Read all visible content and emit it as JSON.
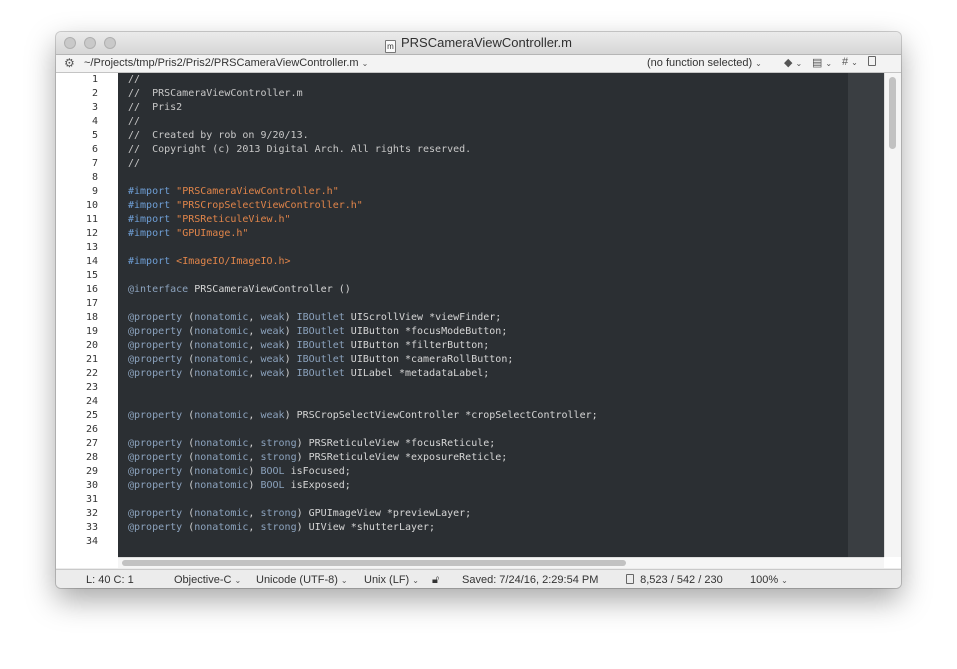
{
  "window": {
    "title": "PRSCameraViewController.m",
    "file_icon_letter": "m"
  },
  "navbar": {
    "path": "~/Projects/tmp/Pris2/Pris2/PRSCameraViewController.m",
    "function_menu": "(no function selected)",
    "caret": "⌄"
  },
  "gutter": {
    "line_numbers": [
      "1",
      "2",
      "3",
      "4",
      "5",
      "6",
      "7",
      "8",
      "9",
      "10",
      "11",
      "12",
      "13",
      "14",
      "15",
      "16",
      "17",
      "18",
      "19",
      "20",
      "21",
      "22",
      "23",
      "24",
      "25",
      "26",
      "27",
      "28",
      "29",
      "30",
      "31",
      "32",
      "33",
      "34"
    ]
  },
  "code": {
    "lines": [
      [
        {
          "t": "c",
          "v": "//"
        }
      ],
      [
        {
          "t": "c",
          "v": "//  PRSCameraViewController.m"
        }
      ],
      [
        {
          "t": "c",
          "v": "//  Pris2"
        }
      ],
      [
        {
          "t": "c",
          "v": "//"
        }
      ],
      [
        {
          "t": "c",
          "v": "//  Created by rob on 9/20/13."
        }
      ],
      [
        {
          "t": "c",
          "v": "//  Copyright (c) 2013 Digital Arch. All rights reserved."
        }
      ],
      [
        {
          "t": "c",
          "v": "//"
        }
      ],
      [],
      [
        {
          "t": "p",
          "v": "#import "
        },
        {
          "t": "s",
          "v": "\"PRSCameraViewController.h\""
        }
      ],
      [
        {
          "t": "p",
          "v": "#import "
        },
        {
          "t": "s",
          "v": "\"PRSCropSelectViewController.h\""
        }
      ],
      [
        {
          "t": "p",
          "v": "#import "
        },
        {
          "t": "s",
          "v": "\"PRSReticuleView.h\""
        }
      ],
      [
        {
          "t": "p",
          "v": "#import "
        },
        {
          "t": "s",
          "v": "\"GPUImage.h\""
        }
      ],
      [],
      [
        {
          "t": "p",
          "v": "#import "
        },
        {
          "t": "s",
          "v": "<ImageIO/ImageIO.h>"
        }
      ],
      [],
      [
        {
          "t": "k",
          "v": "@interface"
        },
        {
          "t": "n",
          "v": " PRSCameraViewController ()"
        }
      ],
      [],
      [
        {
          "t": "k",
          "v": "@property"
        },
        {
          "t": "n",
          "v": " ("
        },
        {
          "t": "k",
          "v": "nonatomic"
        },
        {
          "t": "n",
          "v": ", "
        },
        {
          "t": "k",
          "v": "weak"
        },
        {
          "t": "n",
          "v": ") "
        },
        {
          "t": "k",
          "v": "IBOutlet"
        },
        {
          "t": "n",
          "v": " UIScrollView *viewFinder;"
        }
      ],
      [
        {
          "t": "k",
          "v": "@property"
        },
        {
          "t": "n",
          "v": " ("
        },
        {
          "t": "k",
          "v": "nonatomic"
        },
        {
          "t": "n",
          "v": ", "
        },
        {
          "t": "k",
          "v": "weak"
        },
        {
          "t": "n",
          "v": ") "
        },
        {
          "t": "k",
          "v": "IBOutlet"
        },
        {
          "t": "n",
          "v": " UIButton *focusModeButton;"
        }
      ],
      [
        {
          "t": "k",
          "v": "@property"
        },
        {
          "t": "n",
          "v": " ("
        },
        {
          "t": "k",
          "v": "nonatomic"
        },
        {
          "t": "n",
          "v": ", "
        },
        {
          "t": "k",
          "v": "weak"
        },
        {
          "t": "n",
          "v": ") "
        },
        {
          "t": "k",
          "v": "IBOutlet"
        },
        {
          "t": "n",
          "v": " UIButton *filterButton;"
        }
      ],
      [
        {
          "t": "k",
          "v": "@property"
        },
        {
          "t": "n",
          "v": " ("
        },
        {
          "t": "k",
          "v": "nonatomic"
        },
        {
          "t": "n",
          "v": ", "
        },
        {
          "t": "k",
          "v": "weak"
        },
        {
          "t": "n",
          "v": ") "
        },
        {
          "t": "k",
          "v": "IBOutlet"
        },
        {
          "t": "n",
          "v": " UIButton *cameraRollButton;"
        }
      ],
      [
        {
          "t": "k",
          "v": "@property"
        },
        {
          "t": "n",
          "v": " ("
        },
        {
          "t": "k",
          "v": "nonatomic"
        },
        {
          "t": "n",
          "v": ", "
        },
        {
          "t": "k",
          "v": "weak"
        },
        {
          "t": "n",
          "v": ") "
        },
        {
          "t": "k",
          "v": "IBOutlet"
        },
        {
          "t": "n",
          "v": " UILabel *metadataLabel;"
        }
      ],
      [],
      [],
      [
        {
          "t": "k",
          "v": "@property"
        },
        {
          "t": "n",
          "v": " ("
        },
        {
          "t": "k",
          "v": "nonatomic"
        },
        {
          "t": "n",
          "v": ", "
        },
        {
          "t": "k",
          "v": "weak"
        },
        {
          "t": "n",
          "v": ") PRSCropSelectViewController *cropSelectController;"
        }
      ],
      [],
      [
        {
          "t": "k",
          "v": "@property"
        },
        {
          "t": "n",
          "v": " ("
        },
        {
          "t": "k",
          "v": "nonatomic"
        },
        {
          "t": "n",
          "v": ", "
        },
        {
          "t": "k",
          "v": "strong"
        },
        {
          "t": "n",
          "v": ") PRSReticuleView *focusReticule;"
        }
      ],
      [
        {
          "t": "k",
          "v": "@property"
        },
        {
          "t": "n",
          "v": " ("
        },
        {
          "t": "k",
          "v": "nonatomic"
        },
        {
          "t": "n",
          "v": ", "
        },
        {
          "t": "k",
          "v": "strong"
        },
        {
          "t": "n",
          "v": ") PRSReticuleView *exposureReticle;"
        }
      ],
      [
        {
          "t": "k",
          "v": "@property"
        },
        {
          "t": "n",
          "v": " ("
        },
        {
          "t": "k",
          "v": "nonatomic"
        },
        {
          "t": "n",
          "v": ") "
        },
        {
          "t": "k",
          "v": "BOOL"
        },
        {
          "t": "n",
          "v": " isFocused;"
        }
      ],
      [
        {
          "t": "k",
          "v": "@property"
        },
        {
          "t": "n",
          "v": " ("
        },
        {
          "t": "k",
          "v": "nonatomic"
        },
        {
          "t": "n",
          "v": ") "
        },
        {
          "t": "k",
          "v": "BOOL"
        },
        {
          "t": "n",
          "v": " isExposed;"
        }
      ],
      [],
      [
        {
          "t": "k",
          "v": "@property"
        },
        {
          "t": "n",
          "v": " ("
        },
        {
          "t": "k",
          "v": "nonatomic"
        },
        {
          "t": "n",
          "v": ", "
        },
        {
          "t": "k",
          "v": "strong"
        },
        {
          "t": "n",
          "v": ") GPUImageView *previewLayer;"
        }
      ],
      [
        {
          "t": "k",
          "v": "@property"
        },
        {
          "t": "n",
          "v": " ("
        },
        {
          "t": "k",
          "v": "nonatomic"
        },
        {
          "t": "n",
          "v": ", "
        },
        {
          "t": "k",
          "v": "strong"
        },
        {
          "t": "n",
          "v": ") UIView *shutterLayer;"
        }
      ],
      []
    ]
  },
  "status": {
    "position": "L: 40 C: 1",
    "language": "Objective-C",
    "encoding": "Unicode (UTF-8)",
    "line_endings": "Unix (LF)",
    "saved": "Saved: 7/24/16, 2:29:54 PM",
    "counts": "8,523 / 542 / 230",
    "zoom": "100%"
  },
  "colors": {
    "editor_bg": "#2b2f33",
    "comment": "#c8c8c8",
    "preprocessor": "#6f9fd6",
    "string": "#e1854a",
    "keyword": "#8ca3be"
  },
  "icons": {
    "gear": "gear-icon",
    "marker": "marker-icon",
    "documents": "documents-icon",
    "hash": "hash-icon",
    "new_doc": "new-document-icon",
    "lock": "lock-icon"
  }
}
